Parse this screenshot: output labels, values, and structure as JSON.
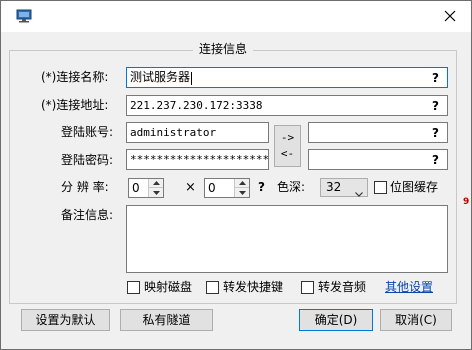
{
  "window": {
    "icon": "computer-icon",
    "close_icon": "close-icon"
  },
  "group": {
    "title": "连接信息"
  },
  "form": {
    "name_label": "(*)连接名称:",
    "name_value": "测试服务器",
    "address_label": "(*)连接地址:",
    "address_value": "221.237.230.172:3338",
    "account_label": "登陆账号:",
    "account_value": "administrator",
    "account_alt_value": "",
    "password_label": "登陆密码:",
    "password_value": "************************",
    "password_alt_value": "",
    "help_mark": "?",
    "swap_right": "->",
    "swap_left": "<-",
    "resolution_label": "分 辨 率:",
    "width_value": "0",
    "height_value": "0",
    "times_sign": "×",
    "resolution_help": "?",
    "color_depth_label": "色深:",
    "color_depth_value": "32",
    "bitmap_cache_label": "位图缓存",
    "bitmap_cache_checked": false,
    "notes_label": "备注信息:",
    "notes_value": ""
  },
  "options": {
    "map_disk_label": "映射磁盘",
    "map_disk_checked": false,
    "forward_hotkeys_label": "转发快捷键",
    "forward_hotkeys_checked": false,
    "forward_audio_label": "转发音频",
    "forward_audio_checked": false,
    "other_settings_link": "其他设置"
  },
  "buttons": {
    "set_default": "设置为默认",
    "private_tunnel": "私有隧道",
    "ok": "确定(D)",
    "cancel": "取消(C)"
  },
  "side_marker": "9"
}
